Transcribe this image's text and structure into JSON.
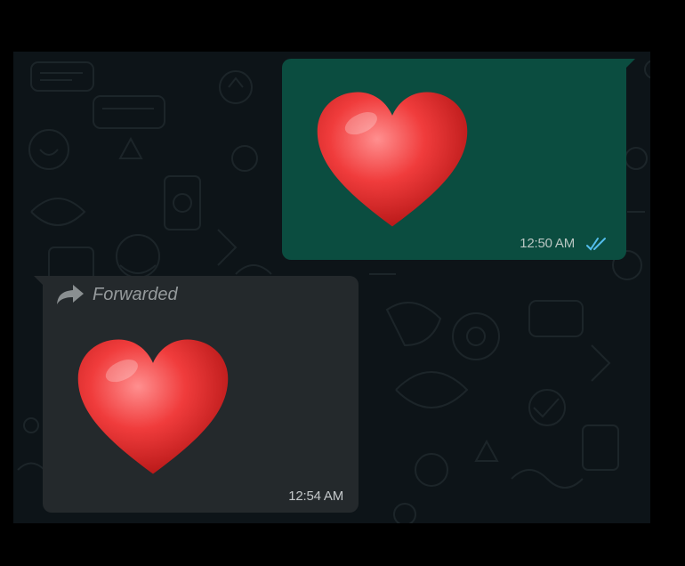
{
  "chat": {
    "messages": [
      {
        "direction": "outgoing",
        "content": "heart-emoji",
        "time": "12:50 AM",
        "status": "read-double-tick"
      },
      {
        "direction": "incoming",
        "forwarded_label": "Forwarded",
        "content": "heart-emoji",
        "time": "12:54 AM"
      }
    ]
  },
  "colors": {
    "background": "#0d1418",
    "outgoing_bubble": "#0b4d40",
    "incoming_bubble": "#24292c",
    "read_tick": "#53bdeb",
    "heart": "#f03c3c"
  }
}
